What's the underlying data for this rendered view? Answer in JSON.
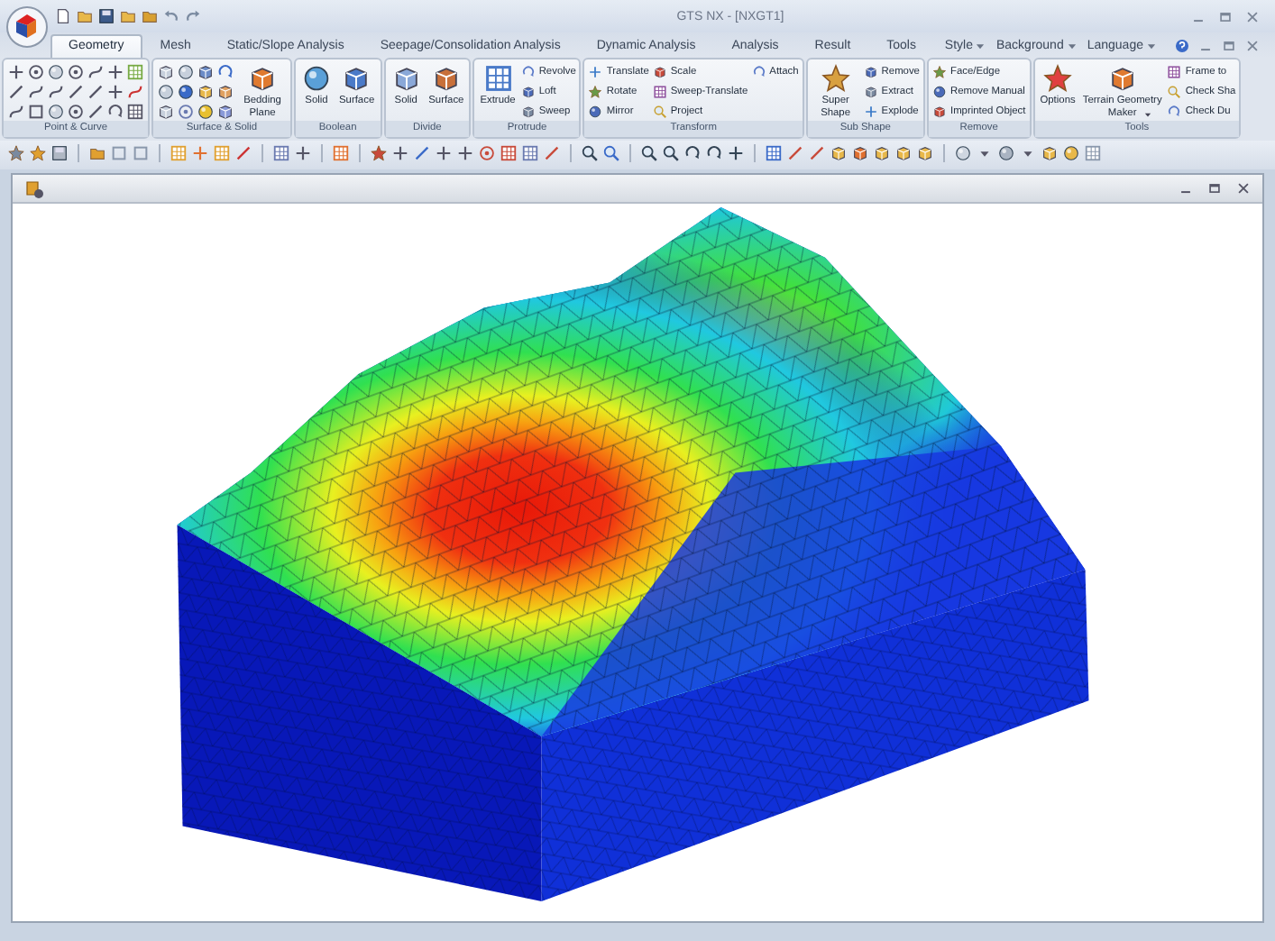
{
  "window": {
    "title": "GTS NX - [NXGT1]"
  },
  "tabs": [
    {
      "label": "Geometry",
      "selected": true
    },
    {
      "label": "Mesh",
      "selected": false
    },
    {
      "label": "Static/Slope Analysis",
      "selected": false
    },
    {
      "label": "Seepage/Consolidation Analysis",
      "selected": false
    },
    {
      "label": "Dynamic Analysis",
      "selected": false
    },
    {
      "label": "Analysis",
      "selected": false
    },
    {
      "label": "Result",
      "selected": false
    },
    {
      "label": "Tools",
      "selected": false
    }
  ],
  "menu_right": [
    {
      "label": "Style"
    },
    {
      "label": "Background"
    },
    {
      "label": "Language"
    }
  ],
  "ribbon_groups": [
    {
      "title": "Point & Curve",
      "columns": [
        {
          "kind": "icon_grid"
        }
      ]
    },
    {
      "title": "Surface & Solid",
      "columns": [
        {
          "kind": "icon_grid"
        },
        {
          "kind": "large",
          "label": "Bedding Plane"
        }
      ]
    },
    {
      "title": "Boolean",
      "columns": [
        {
          "kind": "large",
          "label": "Solid"
        },
        {
          "kind": "large",
          "label": "Surface"
        }
      ]
    },
    {
      "title": "Divide",
      "columns": [
        {
          "kind": "large",
          "label": "Solid"
        },
        {
          "kind": "large",
          "label": "Surface"
        }
      ]
    },
    {
      "title": "Protrude",
      "columns": [
        {
          "kind": "large",
          "label": "Extrude"
        },
        {
          "kind": "stack",
          "items": [
            "Revolve",
            "Loft",
            "Sweep"
          ]
        }
      ]
    },
    {
      "title": "Transform",
      "columns": [
        {
          "kind": "stack",
          "items": [
            "Translate",
            "Rotate",
            "Mirror"
          ]
        },
        {
          "kind": "stack",
          "items": [
            "Scale",
            "Sweep-Translate",
            "Project"
          ]
        },
        {
          "kind": "stack",
          "items": [
            "Attach"
          ]
        }
      ]
    },
    {
      "title": "Sub Shape",
      "columns": [
        {
          "kind": "large",
          "label": "Super Shape"
        },
        {
          "kind": "stack",
          "items": [
            "Remove",
            "Extract",
            "Explode"
          ]
        }
      ]
    },
    {
      "title": "Remove",
      "columns": [
        {
          "kind": "stack",
          "items": [
            "Face/Edge",
            "Remove Manual",
            "Imprinted Object"
          ]
        }
      ]
    },
    {
      "title": "Tools",
      "columns": [
        {
          "kind": "large",
          "label": "Options"
        },
        {
          "kind": "large",
          "label": "Terrain Geometry Maker",
          "dropdown": true
        },
        {
          "kind": "stack",
          "items": [
            "Frame to",
            "Check Sha",
            "Check Du"
          ]
        }
      ]
    }
  ]
}
